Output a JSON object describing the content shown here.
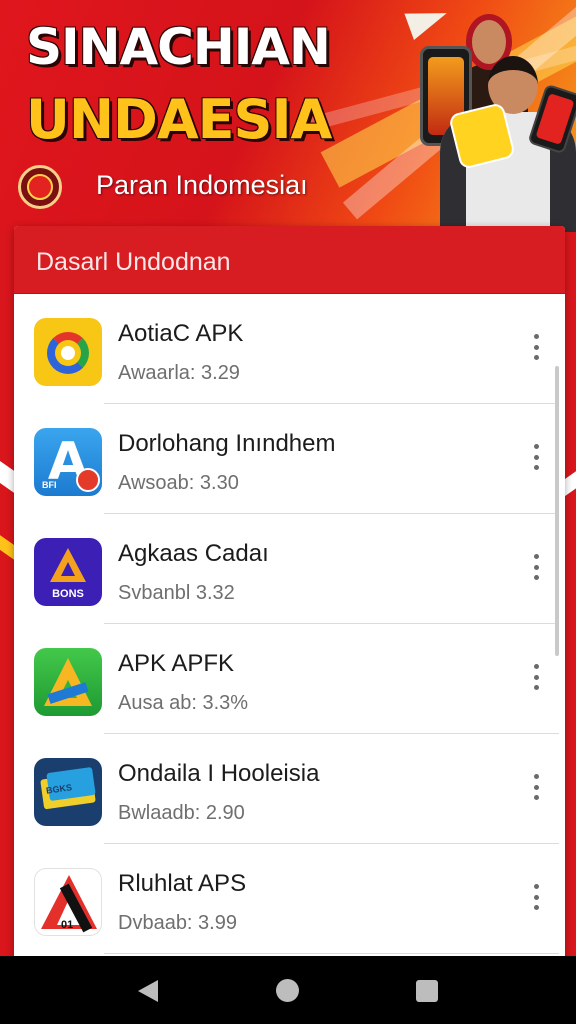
{
  "banner": {
    "title_line1": "SINACHIAN",
    "title_line2": "UNDAESIA",
    "subtitle": "Paran Indomesiaı"
  },
  "panel": {
    "header": "Dasarl Undodnan"
  },
  "apps": [
    {
      "name": "AotiaC APK",
      "sub": "Awaarla: 3.29",
      "icon": "app-icon-yellow-ring",
      "icon_label": ""
    },
    {
      "name": "Dorlohang Inındhem",
      "sub": "Awsoab: 3.30",
      "icon": "app-icon-blue-a",
      "icon_label": "BFI"
    },
    {
      "name": "Agkaas Cadaı",
      "sub": "Svbanbl 3.32",
      "icon": "app-icon-purple-triangle",
      "icon_label": "BONS"
    },
    {
      "name": "APK APFK",
      "sub": "Ausa ab: 3.3%",
      "icon": "app-icon-green-triangle",
      "icon_label": ""
    },
    {
      "name": "Ondaila I Hooleisia",
      "sub": "Bwlaadb: 2.90",
      "icon": "app-icon-cards",
      "icon_label": "BGKS"
    },
    {
      "name": "Rluhlat APS",
      "sub": "Dvbaab: 3.99",
      "icon": "app-icon-red-a",
      "icon_label": "01"
    }
  ],
  "colors": {
    "brand_red": "#d71d22",
    "banner_gold": "#ffc21a",
    "navbar": "#000000"
  },
  "navbar": {
    "icons": [
      "back-icon",
      "home-icon",
      "recents-icon"
    ]
  }
}
